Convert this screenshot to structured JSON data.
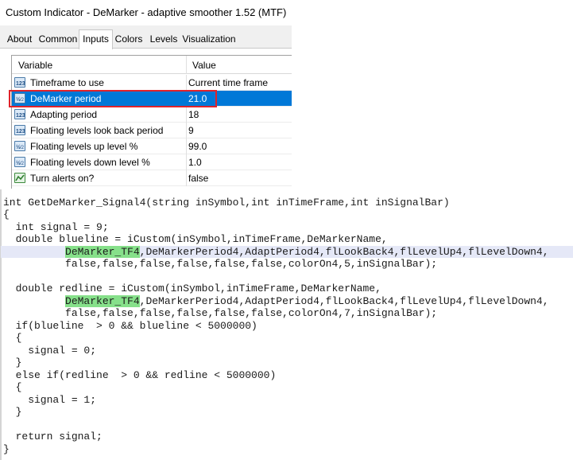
{
  "window": {
    "title": "Custom Indicator - DeMarker - adaptive smoother 1.52 (MTF)"
  },
  "tabs": [
    {
      "label": "About"
    },
    {
      "label": "Common"
    },
    {
      "label": "Inputs"
    },
    {
      "label": "Colors"
    },
    {
      "label": "Levels"
    },
    {
      "label": "Visualization"
    }
  ],
  "active_tab": "Inputs",
  "grid": {
    "col_variable": "Variable",
    "col_value": "Value",
    "rows": [
      {
        "icon": "integer-icon",
        "name": "Timeframe to use",
        "value": "Current time frame"
      },
      {
        "icon": "double-icon",
        "name": "DeMarker period",
        "value": "21.0",
        "selected": true
      },
      {
        "icon": "integer-icon",
        "name": "Adapting period",
        "value": "18"
      },
      {
        "icon": "integer-icon",
        "name": "Floating levels look back period",
        "value": "9"
      },
      {
        "icon": "double-icon",
        "name": "Floating levels up level %",
        "value": "99.0"
      },
      {
        "icon": "double-icon",
        "name": "Floating levels down level %",
        "value": "1.0"
      },
      {
        "icon": "bool-icon",
        "name": "Turn alerts on?",
        "value": "false"
      }
    ]
  },
  "highlight_color": "#e0232b",
  "selection_color": "#0078d7",
  "code": {
    "l1": "int GetDeMarker_Signal4(string inSymbol,int inTimeFrame,int inSignalBar)",
    "l2": "{",
    "l3": "  int signal = 9;",
    "l4": "  double blueline = iCustom(inSymbol,inTimeFrame,DeMarkerName,",
    "l5_indent": "          ",
    "l5_hl": "DeMarker_TF4",
    "l5_rest": ",DeMarkerPeriod4,AdaptPeriod4,flLookBack4,flLevelUp4,flLevelDown4,",
    "l6": "          false,false,false,false,false,false,colorOn4,5,inSignalBar);",
    "l8": "  double redline = iCustom(inSymbol,inTimeFrame,DeMarkerName,",
    "l9_indent": "          ",
    "l9_hl": "DeMarker_TF4",
    "l9_rest": ",DeMarkerPeriod4,AdaptPeriod4,flLookBack4,flLevelUp4,flLevelDown4,",
    "l10": "          false,false,false,false,false,false,colorOn4,7,inSignalBar);",
    "l11": "  if(blueline  > 0 && blueline < 5000000)",
    "l12": "  {",
    "l13": "    signal = 0;",
    "l14": "  }",
    "l15": "  else if(redline  > 0 && redline < 5000000)",
    "l16": "  {",
    "l17": "    signal = 1;",
    "l18": "  }",
    "l20": "  return signal;",
    "l21": "}"
  }
}
